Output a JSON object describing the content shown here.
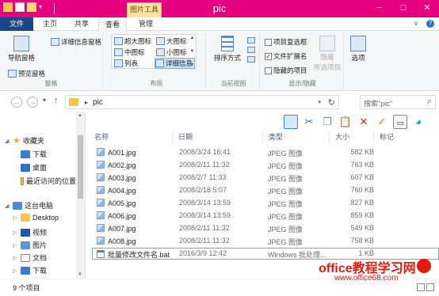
{
  "window": {
    "title": "pic",
    "context_tab": "图片工具",
    "controls": [
      "−",
      "□",
      "✕"
    ]
  },
  "ribbon_tabs": {
    "file": "文件",
    "home": "主页",
    "share": "共享",
    "view": "查看",
    "manage": "管理"
  },
  "ribbon": {
    "pane_group": {
      "nav_pane": "导航窗格",
      "preview_pane": "预览窗格",
      "details_pane": "详细信息窗格",
      "label": "窗格"
    },
    "layout_group": {
      "items": [
        "超大图标",
        "大图标",
        "中图标",
        "小图标",
        "列表",
        "详细信息"
      ],
      "active": "详细信息",
      "label": "布局"
    },
    "current_view_group": {
      "sort_by": "排序方式",
      "label": "当前视图"
    },
    "show_hide_group": {
      "item_checkboxes": "项目复选框",
      "file_extensions": "文件扩展名",
      "hidden_items": "隐藏的项目",
      "hide_selected": "隐藏",
      "hide_selected_2": "所选项目",
      "label": "显示/隐藏",
      "item_checkboxes_checked": false,
      "file_extensions_checked": true,
      "hidden_items_checked": false
    },
    "options": "选项"
  },
  "address": {
    "path": "pic",
    "search_placeholder": "搜索\"pic\""
  },
  "nav_pane": {
    "favorites": "收藏夹",
    "downloads": "下载",
    "desktop": "桌面",
    "recent": "最近访问的位置",
    "this_pc": "这台电脑",
    "pc_items": [
      "Desktop",
      "视频",
      "图片",
      "文档",
      "下载"
    ]
  },
  "file_list": {
    "columns": [
      "名称",
      "日期",
      "类型",
      "大小",
      "标记"
    ],
    "rows": [
      {
        "name": "A001.jpg",
        "date": "2008/3/24 16:41",
        "type": "JPEG 图像",
        "size": "582 KB",
        "icon": "jpg"
      },
      {
        "name": "A002.jpg",
        "date": "2008/2/11 11:32",
        "type": "JPEG 图像",
        "size": "763 KB",
        "icon": "jpg"
      },
      {
        "name": "A003.jpg",
        "date": "2008/2/7 11:33",
        "type": "JPEG 图像",
        "size": "607 KB",
        "icon": "jpg"
      },
      {
        "name": "A004.jpg",
        "date": "2008/2/18 5:07",
        "type": "JPEG 图像",
        "size": "760 KB",
        "icon": "jpg"
      },
      {
        "name": "A005.jpg",
        "date": "2008/3/14 13:59",
        "type": "JPEG 图像",
        "size": "827 KB",
        "icon": "jpg"
      },
      {
        "name": "A006.jpg",
        "date": "2008/3/14 13:59",
        "type": "JPEG 图像",
        "size": "859 KB",
        "icon": "jpg"
      },
      {
        "name": "A007.jpg",
        "date": "2008/2/11 11:32",
        "type": "JPEG 图像",
        "size": "549 KB",
        "icon": "jpg"
      },
      {
        "name": "A008.jpg",
        "date": "2008/2/11 11:32",
        "type": "JPEG 图像",
        "size": "758 KB",
        "icon": "jpg"
      },
      {
        "name": "批量修改文件名.bat",
        "date": "2016/3/9 12:42",
        "type": "Windows 批处理...",
        "size": "1 KB",
        "icon": "bat"
      }
    ]
  },
  "status": {
    "item_count": "9 个项目"
  },
  "watermark": {
    "text": "office教程学习网",
    "url": "www.office68.com"
  },
  "colors": {
    "titlebar": "#e5007f",
    "file_tab": "#19478a",
    "context_tab": "#f9e4a0",
    "watermark": "#e21a12"
  }
}
